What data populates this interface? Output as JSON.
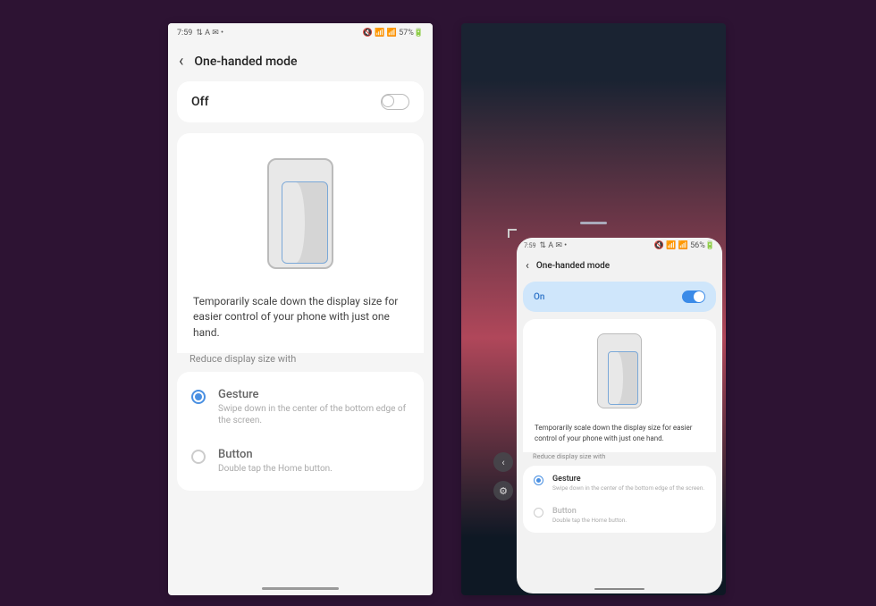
{
  "left": {
    "status": {
      "time": "7:59",
      "icons_left": "⇅ A ✉ •",
      "icons_right": "🔇 📶 📶 57%🔋",
      "battery": "57%"
    },
    "title": "One-handed mode",
    "toggle": {
      "state": "Off"
    },
    "description": "Temporarily scale down the display size for easier control of your phone with just one hand.",
    "section_label": "Reduce display size with",
    "options": [
      {
        "title": "Gesture",
        "sub": "Swipe down in the center of the bottom edge of the screen.",
        "checked": true
      },
      {
        "title": "Button",
        "sub": "Double tap the Home button.",
        "checked": false
      }
    ]
  },
  "right": {
    "status": {
      "time": "7:59",
      "icons_left": "⇅ A ✉ •",
      "icons_right": "🔇 📶 📶 56%🔋",
      "battery": "56%"
    },
    "title": "One-handed mode",
    "toggle": {
      "state": "On"
    },
    "description": "Temporarily scale down the display size for easier control of your phone with just one hand.",
    "section_label": "Reduce display size with",
    "options": [
      {
        "title": "Gesture",
        "sub": "Swipe down in the center of the bottom edge of the screen.",
        "checked": true
      },
      {
        "title": "Button",
        "sub": "Double tap the Home button.",
        "checked": false
      }
    ],
    "float_buttons": {
      "arrow": "‹",
      "gear": "⚙"
    }
  }
}
